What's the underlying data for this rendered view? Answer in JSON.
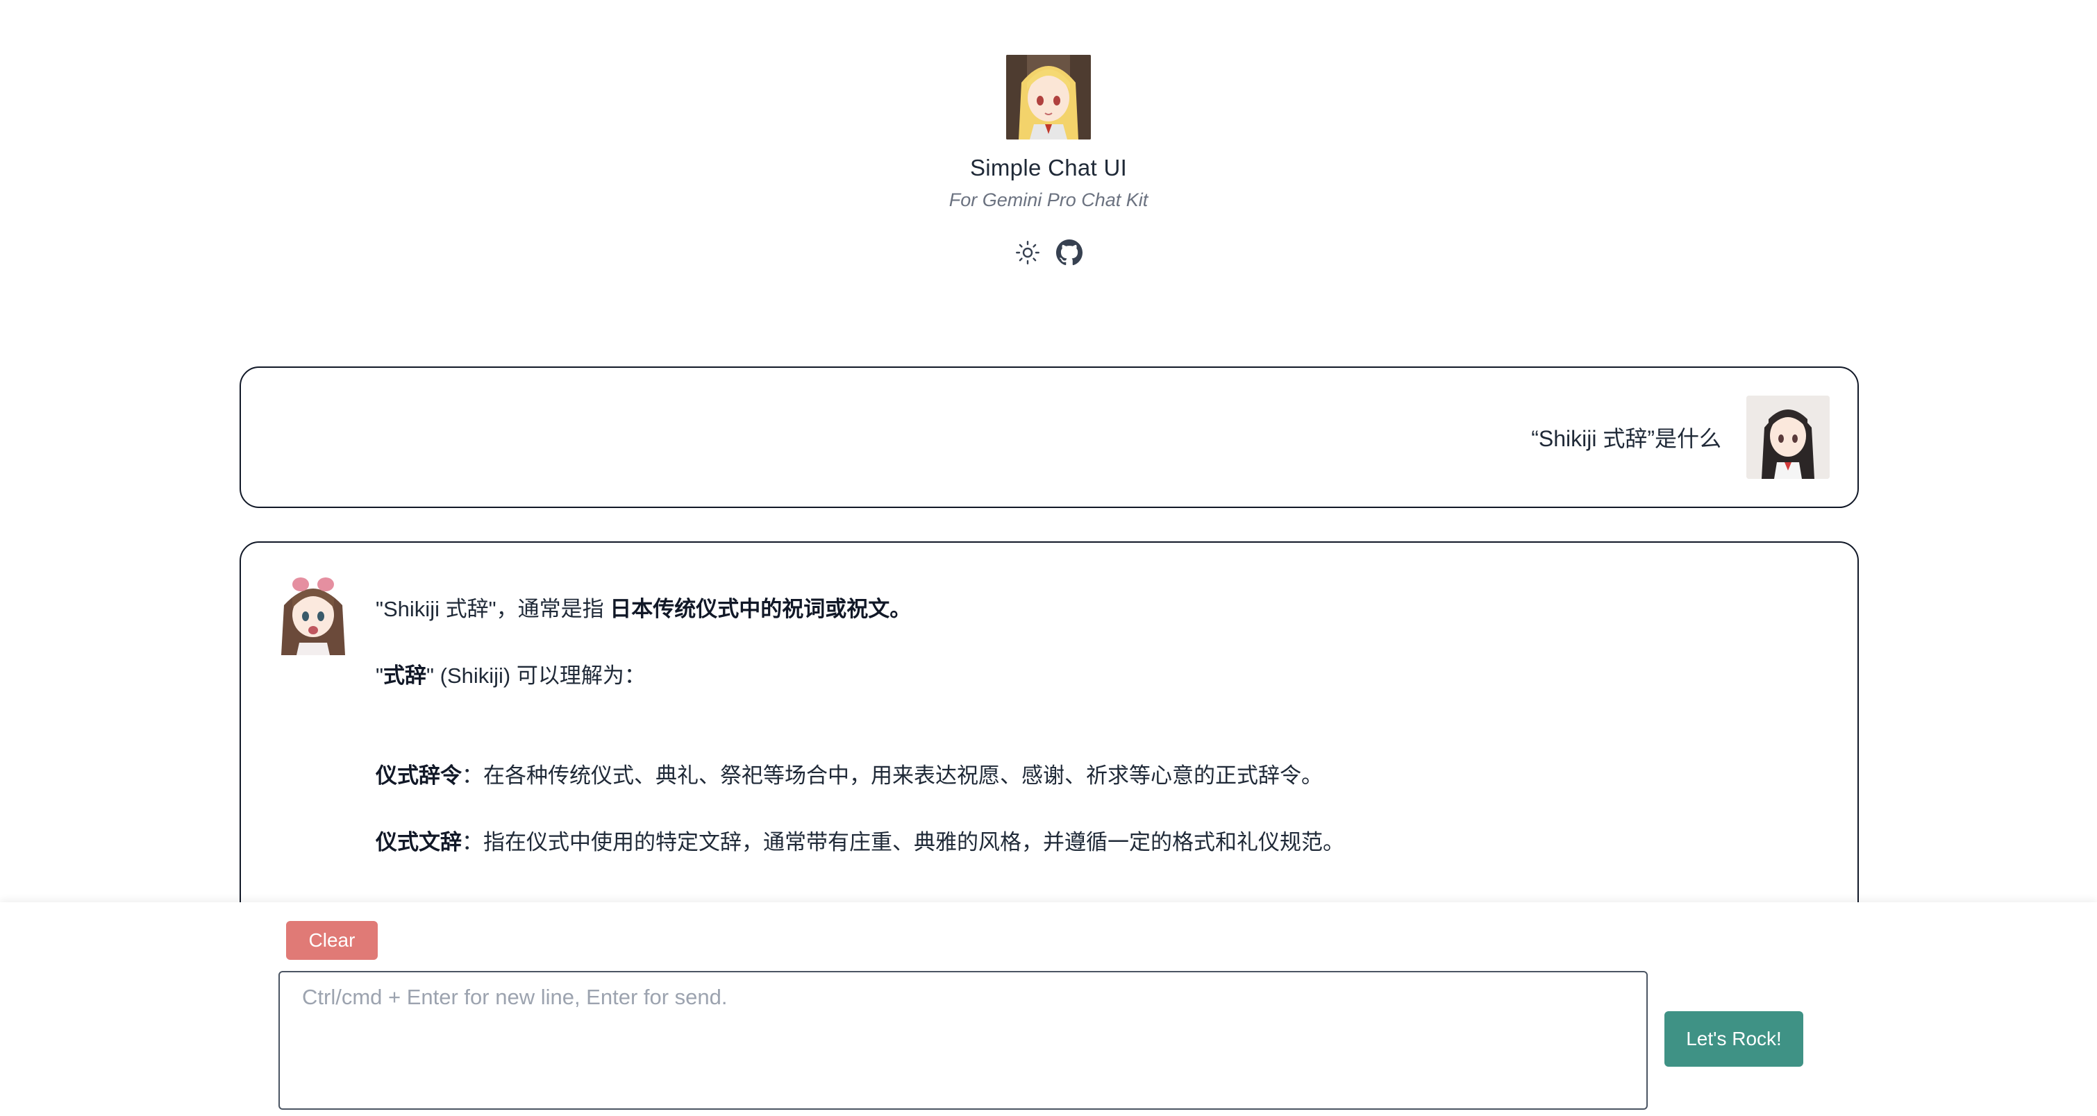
{
  "header": {
    "title": "Simple Chat UI",
    "subtitle": "For Gemini Pro Chat Kit",
    "logo_icon": "anime-girl-blonde-avatar",
    "theme_icon": "sun-icon",
    "github_icon": "github-icon"
  },
  "messages": {
    "user": {
      "text": "“Shikiji 式辞”是什么",
      "avatar_icon": "anime-girl-dark-hair-avatar"
    },
    "bot": {
      "avatar_icon": "anime-girl-bow-avatar",
      "p1_plain": "\"Shikiji 式辞\"，通常是指 ",
      "p1_bold": "日本传统仪式中的祝词或祝文。",
      "p2_q1": "\"",
      "p2_bold": "式辞",
      "p2_rest": "\" (Shikiji) 可以理解为：",
      "li1_bold": "仪式辞令",
      "li1_text": "：在各种传统仪式、典礼、祭祀等场合中，用来表达祝愿、感谢、祈求等心意的正式辞令。",
      "li2_bold": "仪式文辞",
      "li2_text": "：指在仪式中使用的特定文辞，通常带有庄重、典雅的风格，并遵循一定的格式和礼仪规范。"
    }
  },
  "composer": {
    "clear_label": "Clear",
    "placeholder": "Ctrl/cmd + Enter for new line, Enter for send.",
    "send_label": "Let's Rock!"
  },
  "colors": {
    "clear_button": "#e07a76",
    "send_button": "#3f9285",
    "border": "#111827"
  }
}
